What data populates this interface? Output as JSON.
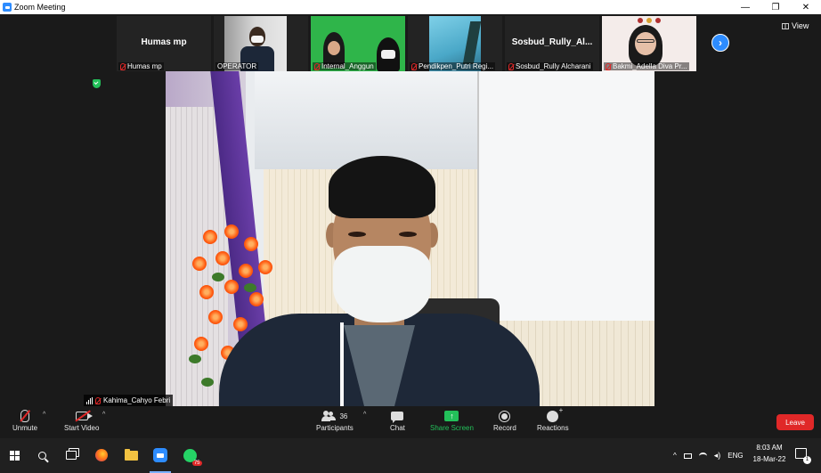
{
  "window": {
    "title": "Zoom Meeting",
    "controls": [
      "—",
      "❐",
      "✕"
    ]
  },
  "thumbnails": [
    {
      "name": "Humas mp",
      "label": "Humas mp",
      "type": "name"
    },
    {
      "name": "",
      "label": "OPERATOR",
      "type": "video-operator"
    },
    {
      "name": "",
      "label": "Internal_Anggun",
      "type": "video-green"
    },
    {
      "name": "",
      "label": "Pendikpen_Putri Regi...",
      "type": "video-sky"
    },
    {
      "name": "Sosbud_Rully_Al...",
      "label": "Sosbud_Rully Alcharani",
      "type": "name"
    },
    {
      "name": "",
      "label": "Bakmi_Adella Diva Pr...",
      "type": "video-girl"
    }
  ],
  "view": {
    "label": "View"
  },
  "next": {
    "glyph": "›"
  },
  "speaker": {
    "label": "Kahima_Cahyo Febri"
  },
  "toolbar": {
    "unmute": "Unmute",
    "start_video": "Start Video",
    "participants": "Participants",
    "participants_count": "36",
    "chat": "Chat",
    "share_screen": "Share Screen",
    "share_glyph": "↑",
    "record": "Record",
    "reactions": "Reactions",
    "leave": "Leave",
    "caret": "^"
  },
  "taskbar": {
    "whatsapp_badge": "75",
    "tray_caret": "^",
    "language": "ENG",
    "time": "8:03 AM",
    "date": "18-Mar-22",
    "notification_count": "1"
  },
  "colors": {
    "zoom_blue": "#2d8cff",
    "leave_red": "#e02828",
    "share_green": "#23c05a",
    "background": "#1a1a1a"
  }
}
